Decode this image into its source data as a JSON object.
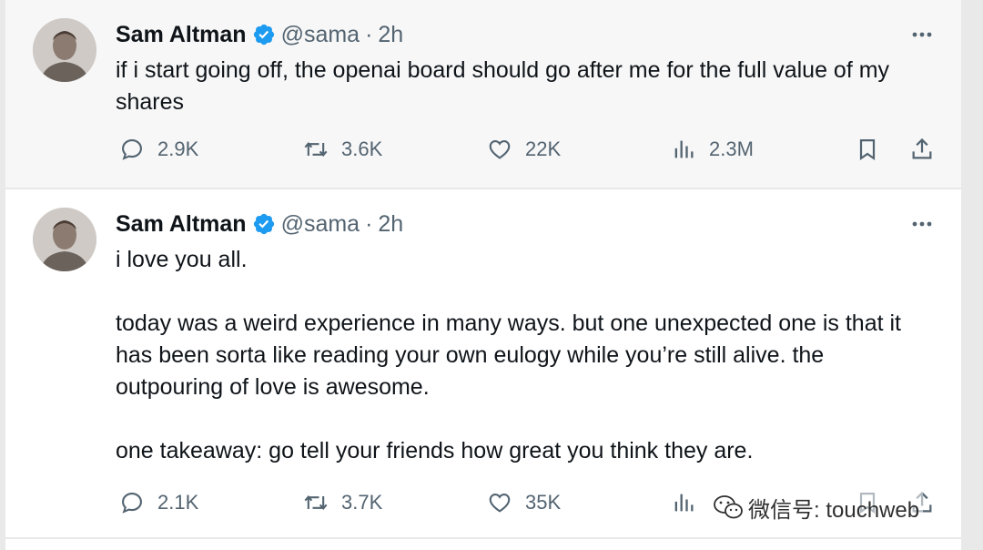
{
  "tweets": [
    {
      "author": "Sam Altman",
      "handle": "@sama",
      "separator": "·",
      "time": "2h",
      "text": "if i start going off, the openai board should go after me for the full value of my shares",
      "replies": "2.9K",
      "retweets": "3.6K",
      "likes": "22K",
      "views": "2.3M"
    },
    {
      "author": "Sam Altman",
      "handle": "@sama",
      "separator": "·",
      "time": "2h",
      "text": "i love you all.\n\ntoday was a weird experience in many ways. but one unexpected one is that it has been sorta like reading your own eulogy while you’re still alive. the outpouring of love is awesome.\n\none takeaway: go tell your friends how great you think they are.",
      "replies": "2.1K",
      "retweets": "3.7K",
      "likes": "35K"
    }
  ],
  "watermark": {
    "text": "微信号: touchweb",
    "icon": "wechat-icon"
  },
  "colors": {
    "verified": "#1d9bf0",
    "secondary_text": "#536471",
    "primary_text": "#0f1419"
  }
}
